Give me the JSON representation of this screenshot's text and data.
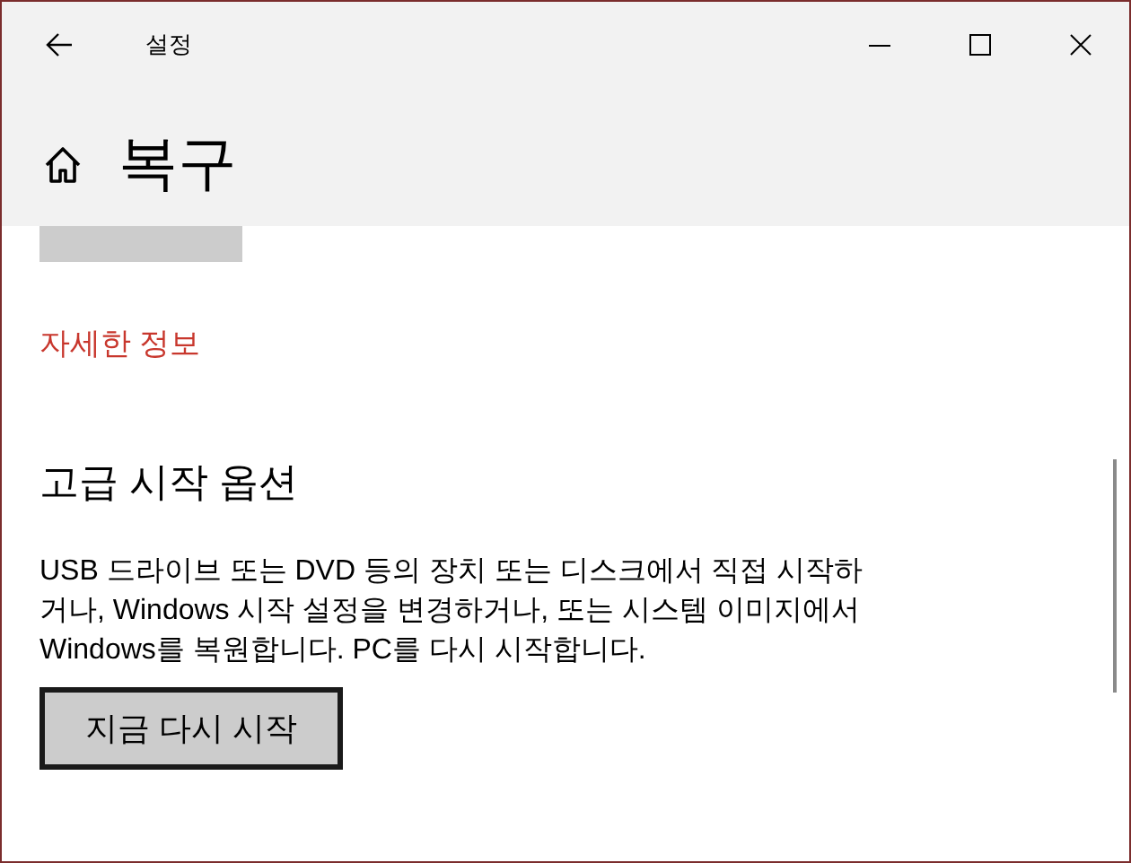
{
  "window": {
    "title": "설정"
  },
  "header": {
    "title": "복구"
  },
  "previous_button": {
    "disabled": true
  },
  "details_link": "자세한 정보",
  "advanced_startup": {
    "heading": "고급 시작 옵션",
    "description_lines": [
      "USB 드라이브 또는 DVD 등의 장치 또는 디스크에서 직접 시작하",
      "거나, Windows 시작 설정을 변경하거나, 또는 시스템 이미지에서",
      "Windows를 복원합니다. PC를 다시 시작합니다."
    ],
    "button": {
      "label": "지금 다시 시작",
      "focused": true
    }
  }
}
